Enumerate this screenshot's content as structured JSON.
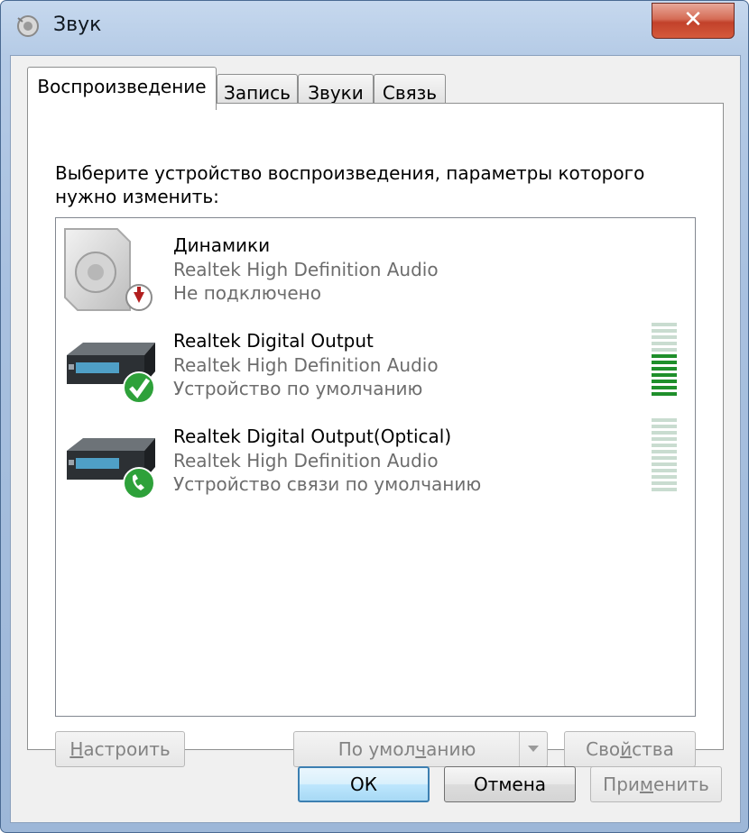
{
  "window": {
    "title": "Звук",
    "close_glyph": "✕"
  },
  "tabs": [
    {
      "label": "Воспроизведение",
      "active": true
    },
    {
      "label": "Запись",
      "active": false
    },
    {
      "label": "Звуки",
      "active": false
    },
    {
      "label": "Связь",
      "active": false
    }
  ],
  "description": "Выберите устройство воспроизведения, параметры которого нужно изменить:",
  "devices": [
    {
      "name": "Динамики",
      "driver": "Realtek High Definition Audio",
      "status": "Не подключено",
      "icon": "speaker-icon",
      "badge": "disconnected-badge-icon",
      "meter_level": null
    },
    {
      "name": "Realtek Digital Output",
      "driver": "Realtek High Definition Audio",
      "status": "Устройство по умолчанию",
      "icon": "receiver-icon",
      "badge": "default-check-icon",
      "meter_level": 0.55
    },
    {
      "name": "Realtek Digital Output(Optical)",
      "driver": "Realtek High Definition Audio",
      "status": "Устройство связи по умолчанию",
      "icon": "receiver-icon",
      "badge": "phone-badge-icon",
      "meter_level": 0
    }
  ],
  "buttons": {
    "configure_pre": "",
    "configure_ul": "Н",
    "configure_post": "астроить",
    "set_default_pre": "По умол",
    "set_default_ul": "ч",
    "set_default_post": "анию",
    "properties_pre": "Сво",
    "properties_ul": "й",
    "properties_post": "ства",
    "ok": "ОК",
    "cancel": "Отмена",
    "apply_pre": "При",
    "apply_ul": "м",
    "apply_post": "енить"
  },
  "colors": {
    "meter_green": "#1f8f2b",
    "meter_idle": "#c9dcd0",
    "close_red": "#c2412a",
    "focus_blue": "#3c7fb1"
  }
}
